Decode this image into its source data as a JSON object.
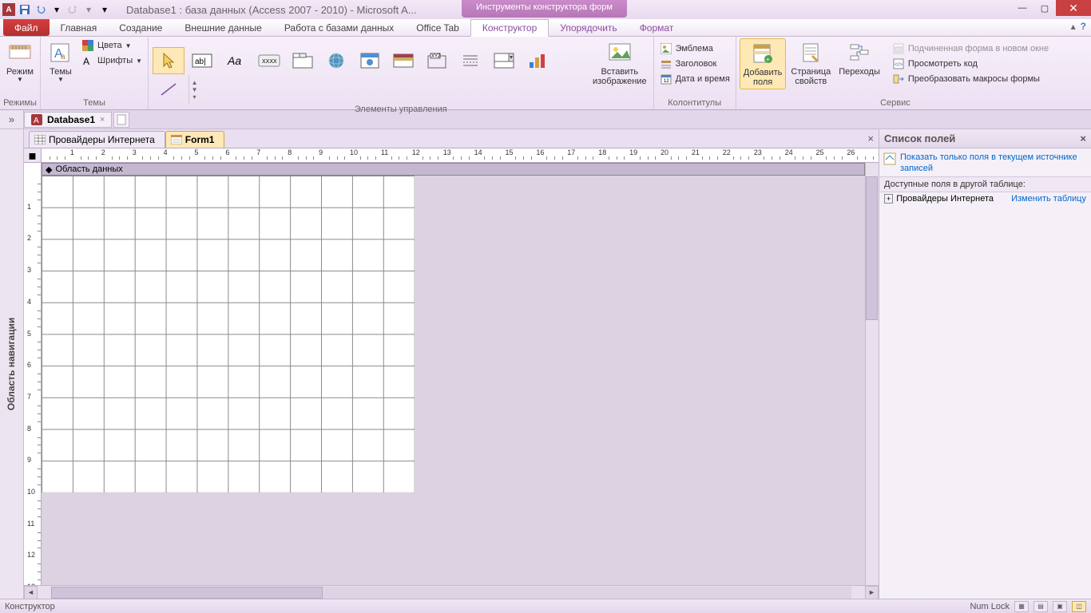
{
  "titlebar": {
    "title": "Database1 : база данных (Access 2007 - 2010)  -  Microsoft A...",
    "contextual": "Инструменты конструктора форм"
  },
  "tabs": {
    "file": "Файл",
    "items": [
      "Главная",
      "Создание",
      "Внешние данные",
      "Работа с базами данных",
      "Office Tab",
      "Конструктор",
      "Упорядочить",
      "Формат"
    ],
    "activeIndex": 5
  },
  "ribbon": {
    "modes": {
      "label": "Режим",
      "group": "Режимы"
    },
    "themes": {
      "label": "Темы",
      "colors": "Цвета",
      "fonts": "Шрифты",
      "group": "Темы"
    },
    "controls": {
      "insertImage": "Вставить\nизображение",
      "group": "Элементы управления"
    },
    "headfoot": {
      "emblem": "Эмблема",
      "title": "Заголовок",
      "datetime": "Дата и время",
      "group": "Колонтитулы"
    },
    "tools": {
      "addFields": "Добавить\nполя",
      "propSheet": "Страница\nсвойств",
      "tabOrder": "Переходы"
    },
    "service": {
      "subform": "Подчиненная форма в новом окне",
      "viewCode": "Просмотреть код",
      "convertMacros": "Преобразовать макросы формы",
      "group": "Сервис"
    }
  },
  "docTabs": {
    "db": "Database1"
  },
  "navRail": "Область навигации",
  "formTabs": {
    "t1": "Провайдеры Интернета",
    "t2": "Form1"
  },
  "section": "Область данных",
  "fieldPane": {
    "title": "Список полей",
    "showCurrent": "Показать только поля в текущем источнике записей",
    "availLabel": "Доступные поля в другой таблице:",
    "table": "Провайдеры Интернета",
    "editLink": "Изменить таблицу"
  },
  "statusbar": {
    "left": "Конструктор",
    "numlock": "Num Lock"
  }
}
